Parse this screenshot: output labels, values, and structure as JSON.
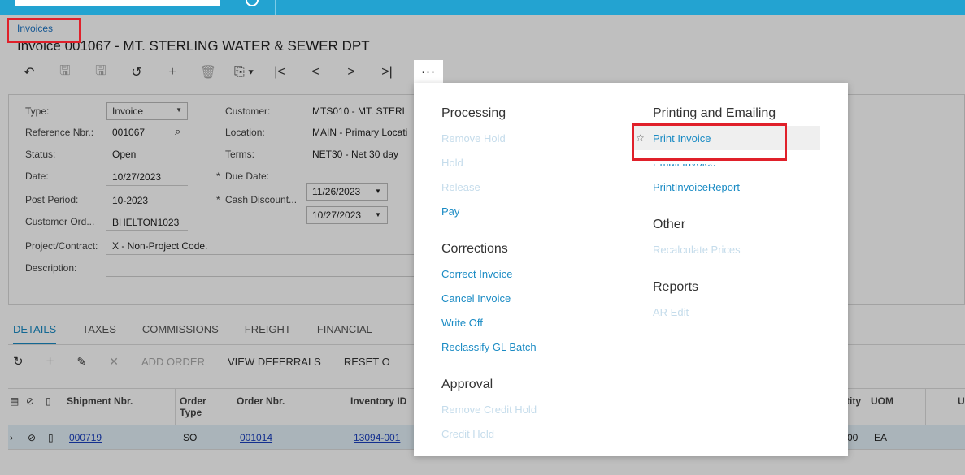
{
  "breadcrumb": "Invoices",
  "title": "Invoice 001067 - MT. STERLING WATER & SEWER DPT",
  "toolbar": {
    "back": "↶",
    "save_close": "🖫",
    "save": "🖫",
    "undo": "↺",
    "add": "+",
    "delete": "🗑",
    "copy": "⎘ ▾",
    "first": "|<",
    "prev": "<",
    "next": ">",
    "last": ">|",
    "more": "···"
  },
  "form": {
    "type_label": "Type:",
    "type_value": "Invoice",
    "ref_label": "Reference Nbr.:",
    "ref_value": "001067",
    "status_label": "Status:",
    "status_value": "Open",
    "date_label": "Date:",
    "date_value": "10/27/2023",
    "post_label": "Post Period:",
    "post_value": "10-2023",
    "custord_label": "Customer Ord...",
    "custord_value": "BHELTON1023",
    "project_label": "Project/Contract:",
    "project_value": "X - Non-Project Code.",
    "desc_label": "Description:",
    "customer_label": "Customer:",
    "customer_value": "MTS010 - MT. STERL",
    "location_label": "Location:",
    "location_value": "MAIN - Primary Locati",
    "terms_label": "Terms:",
    "terms_value": "NET30 - Net 30 day",
    "due_label": "Due Date:",
    "due_value": "11/26/2023",
    "cash_label": "Cash Discount...",
    "cash_value": "10/27/2023"
  },
  "tabs": [
    "DETAILS",
    "TAXES",
    "COMMISSIONS",
    "FREIGHT",
    "FINANCIAL"
  ],
  "gridbar": {
    "add_order": "ADD ORDER",
    "view_deferrals": "VIEW DEFERRALS",
    "reset": "RESET O"
  },
  "grid": {
    "headers": [
      "Shipment Nbr.",
      "Order\nType",
      "Order Nbr.",
      "Inventory ID",
      "tity",
      "UOM",
      "U"
    ],
    "row": {
      "shipment": "000719",
      "order_type": "SO",
      "order_nbr": "001014",
      "inventory": "13094-001",
      "qty": "00",
      "uom": "EA"
    }
  },
  "menu": {
    "processing": "Processing",
    "remove_hold": "Remove Hold",
    "hold": "Hold",
    "release": "Release",
    "pay": "Pay",
    "corrections": "Corrections",
    "correct_invoice": "Correct Invoice",
    "cancel_invoice": "Cancel Invoice",
    "write_off": "Write Off",
    "reclassify": "Reclassify GL Batch",
    "approval": "Approval",
    "remove_credit_hold": "Remove Credit Hold",
    "credit_hold": "Credit Hold",
    "printing": "Printing and Emailing",
    "print_invoice": "Print Invoice",
    "email_invoice": "Email Invoice",
    "print_invoice_report": "PrintInvoiceReport",
    "other": "Other",
    "recalculate": "Recalculate Prices",
    "reports": "Reports",
    "ar_edit": "AR Edit"
  }
}
